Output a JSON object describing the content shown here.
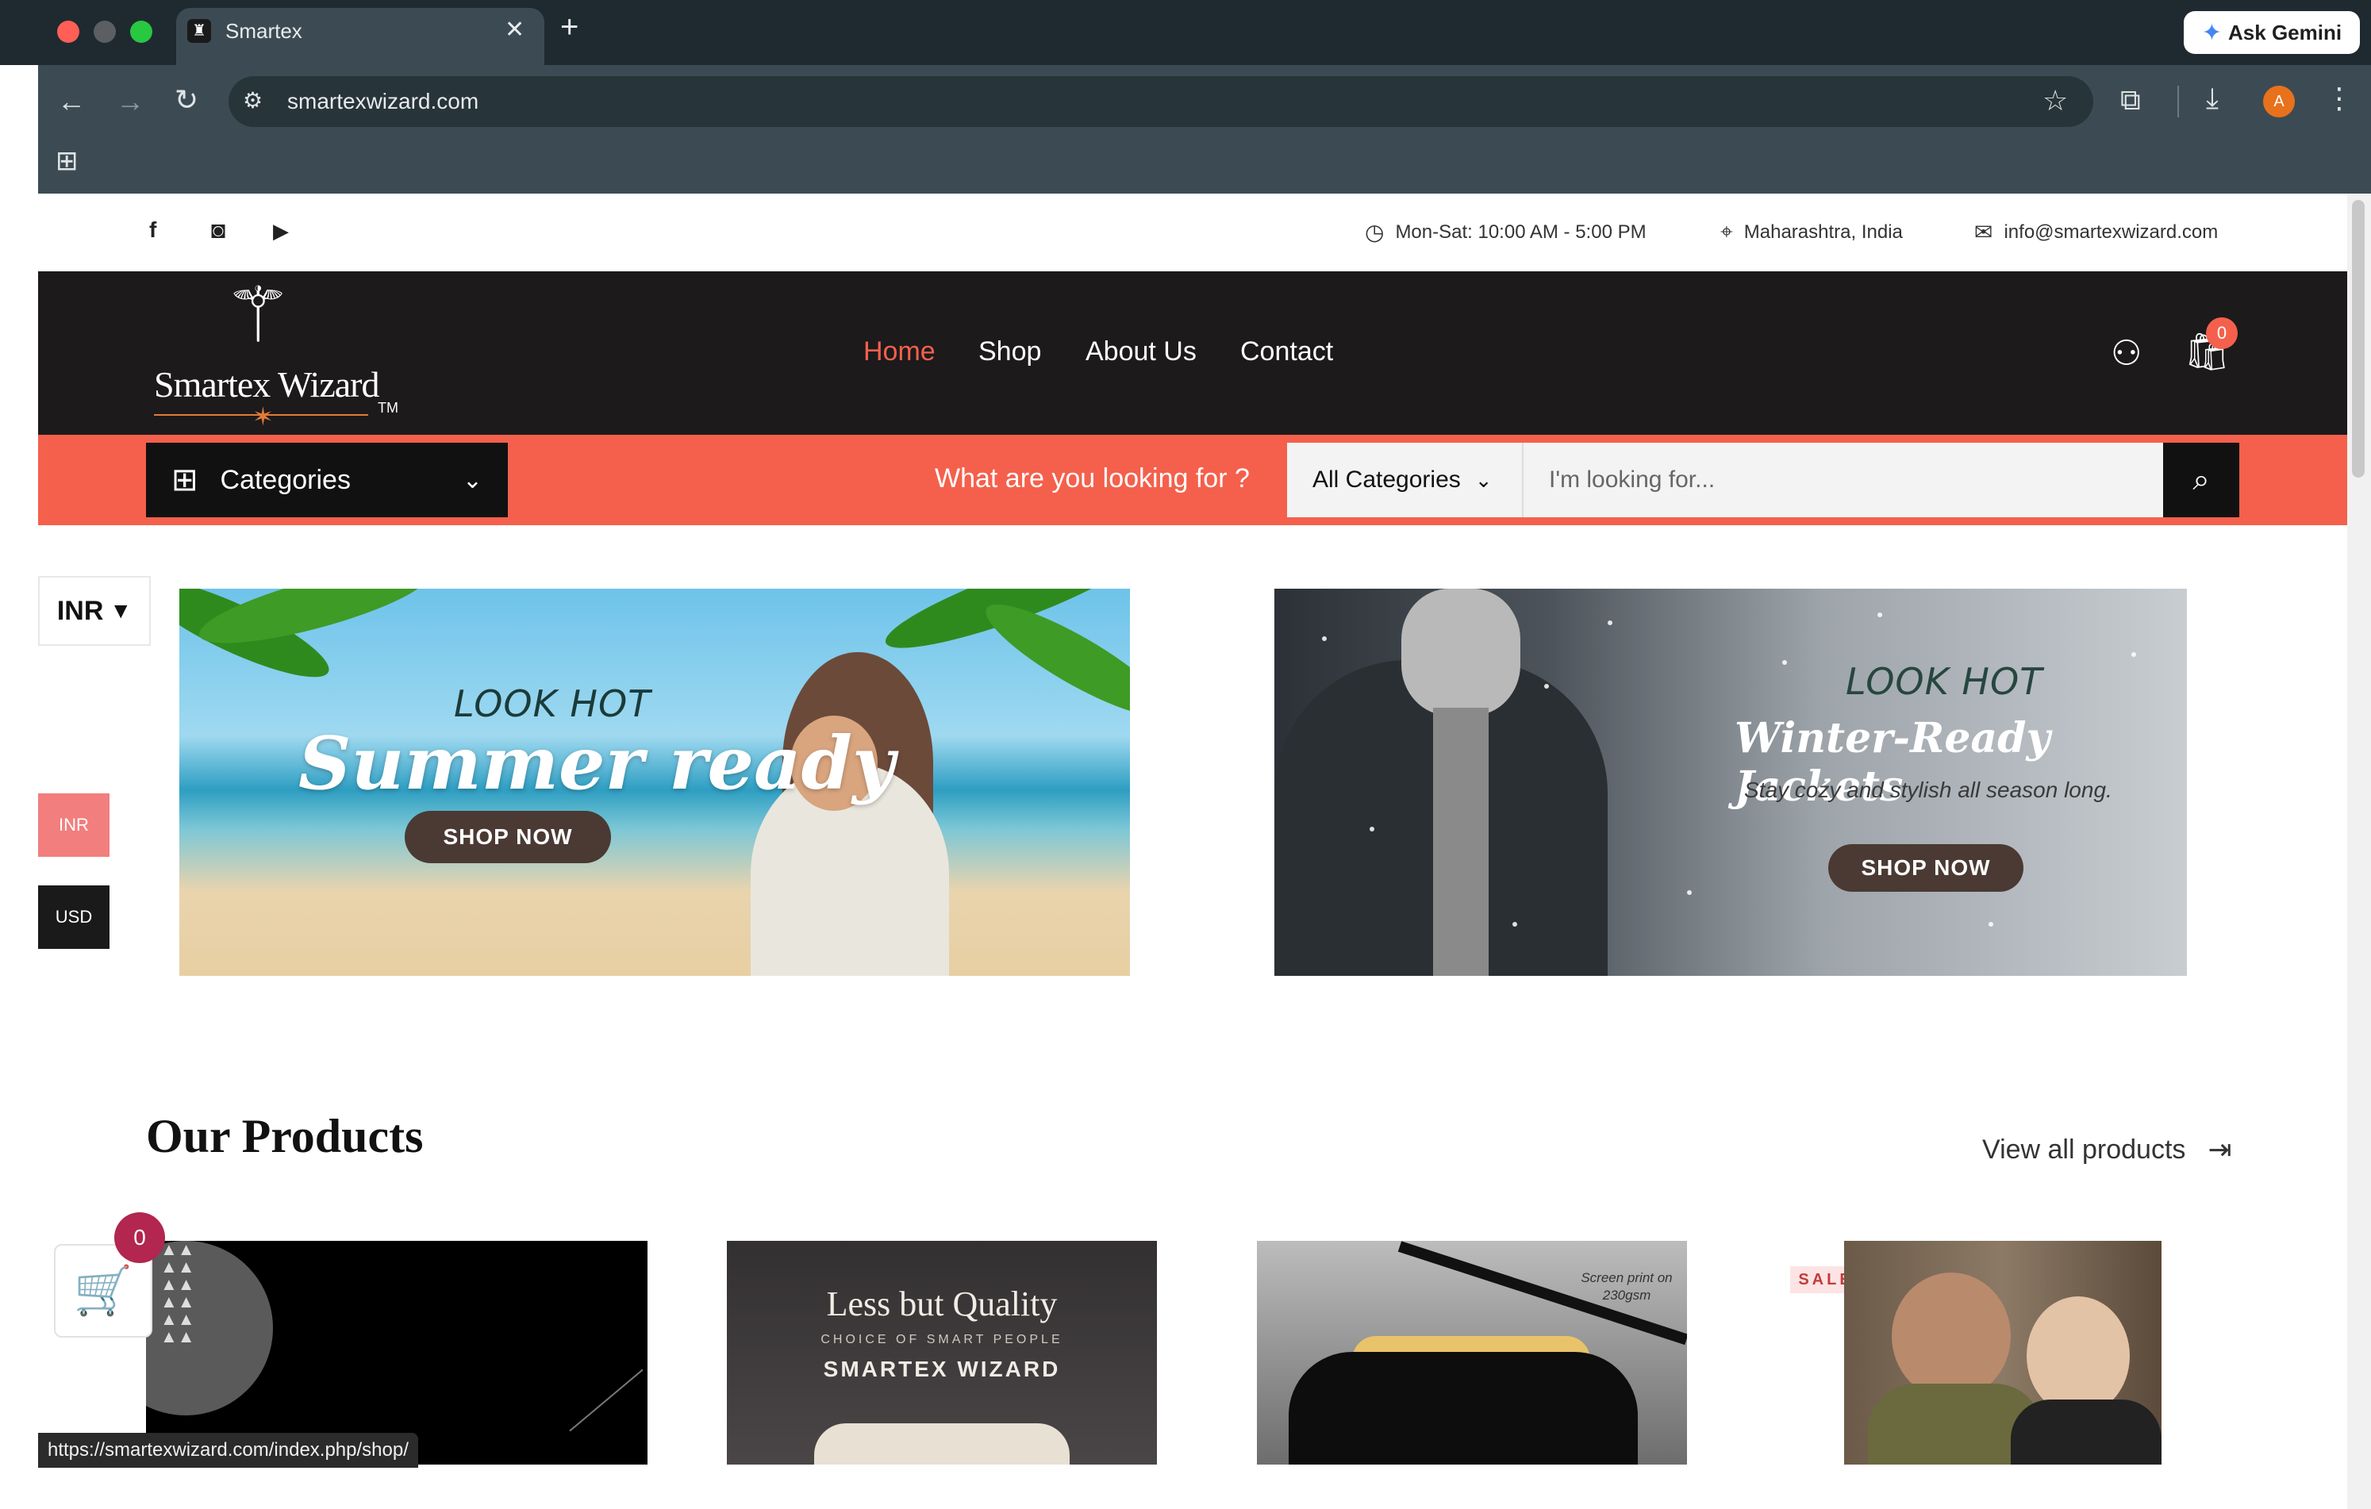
{
  "browser": {
    "tab_title": "Smartex",
    "tab_close": "✕",
    "new_tab": "+",
    "ask_gemini": "Ask Gemini",
    "url": "smartexwizard.com",
    "avatar_letter": "A",
    "status_url": "https://smartexwizard.com/index.php/shop/"
  },
  "topbar": {
    "hours": "Mon-Sat: 10:00 AM - 5:00 PM",
    "location": "Maharashtra, India",
    "email": "info@smartexwizard.com"
  },
  "header": {
    "logo_text": "Smartex Wizard",
    "logo_tm": "TM",
    "nav": [
      "Home",
      "Shop",
      "About Us",
      "Contact"
    ],
    "cart_count": "0"
  },
  "searchbar": {
    "categories_label": "Categories",
    "prompt": "What are you looking for ?",
    "all_categories": "All Categories",
    "placeholder": "I'm looking for..."
  },
  "currency": {
    "selected": "INR",
    "options": [
      "INR",
      "USD"
    ]
  },
  "banners": {
    "summer": {
      "kicker": "LOOK HOT",
      "headline": "Summer ready",
      "cta": "SHOP NOW"
    },
    "winter": {
      "kicker": "LOOK HOT",
      "headline": "Winter-Ready Jackets",
      "tagline": "Stay cozy and stylish all season long.",
      "cta": "SHOP NOW"
    }
  },
  "products": {
    "title": "Our Products",
    "view_all": "View all products",
    "sale_badge": "SALE",
    "card2_title": "Less but Quality",
    "card2_sub": "CHOICE OF SMART PEOPLE",
    "card2_brand": "SMARTEX WIZARD",
    "card3_tag": "Screen print on 230gsm",
    "floating_cart_count": "0"
  },
  "colors": {
    "accent": "#f4604c",
    "header_bg": "#1c1a1b",
    "cart_badge": "#b2264f"
  },
  "icons": {
    "social": [
      "facebook-icon",
      "instagram-icon",
      "youtube-icon"
    ],
    "info": [
      "clock-icon",
      "location-pin-icon",
      "mail-icon"
    ]
  }
}
